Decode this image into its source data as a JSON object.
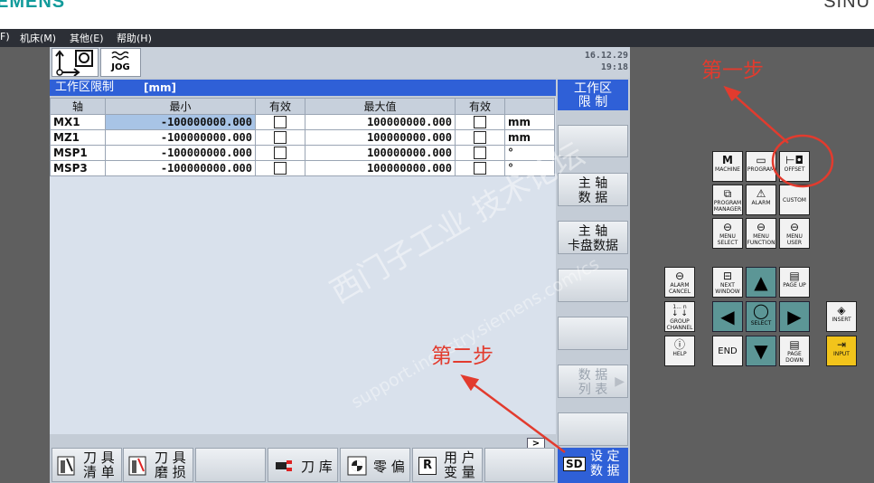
{
  "brand": {
    "left": "EMENS",
    "right": "SINU"
  },
  "menu": [
    "F)",
    "机床(M)",
    "其他(E)",
    "帮助(H)"
  ],
  "header": {
    "mode_label": "JOG",
    "date": "16.12.29",
    "time": "19:18"
  },
  "panel": {
    "title": "工作区限制",
    "unit": "[mm]"
  },
  "table": {
    "headers": [
      "轴",
      "最小",
      "有效",
      "最大值",
      "有效",
      ""
    ],
    "rows": [
      {
        "axis": "MX1",
        "min": "-100000000.000",
        "max": "100000000.000",
        "unit": "mm"
      },
      {
        "axis": "MZ1",
        "min": "-100000000.000",
        "max": "100000000.000",
        "unit": "mm"
      },
      {
        "axis": "MSP1",
        "min": "-100000000.000",
        "max": "100000000.000",
        "unit": "°"
      },
      {
        "axis": "MSP3",
        "min": "-100000000.000",
        "max": "100000000.000",
        "unit": "°"
      }
    ]
  },
  "more_label": ">",
  "vsoftkeys": [
    {
      "line1": "工作区",
      "line2": "限 制"
    },
    {
      "line1": "",
      "line2": ""
    },
    {
      "line1": "主 轴",
      "line2": "数 据"
    },
    {
      "line1": "主  轴",
      "line2": "卡盘数据"
    },
    {
      "line1": "",
      "line2": ""
    },
    {
      "line1": "",
      "line2": ""
    },
    {
      "line1": "数 据",
      "line2": "列 表"
    },
    {
      "line1": "",
      "line2": ""
    }
  ],
  "hsoftkeys": [
    {
      "line1": "刀 具",
      "line2": "清 单"
    },
    {
      "line1": "刀 具",
      "line2": "磨 损"
    },
    {
      "line1": "",
      "line2": ""
    },
    {
      "label": "刀 库"
    },
    {
      "label": "零 偏"
    },
    {
      "line1": "用 户",
      "line2": "变 量"
    },
    {
      "line1": "",
      "line2": ""
    }
  ],
  "sd": {
    "badge": "SD",
    "line1": "设 定",
    "line2": "数 据"
  },
  "keys": {
    "machine": "MACHINE",
    "program": "PROGRAM",
    "offset": "OFFSET",
    "program_manager": "PROGRAM MANAGER",
    "alarm": "ALARM",
    "custom": "CUSTOM",
    "menu_select": "MENU SELECT",
    "menu_function": "MENU FUNCTION",
    "menu_user": "MENU USER",
    "alarm_cancel": "ALARM CANCEL",
    "next_window": "NEXT WINDOW",
    "page_up": "PAGE UP",
    "group_channel": "GROUP CHANNEL",
    "select": "SELECT",
    "insert": "INSERT",
    "help": "HELP",
    "end": "END",
    "page_down": "PAGE DOWN",
    "input": "INPUT",
    "group_nums": "1... n"
  },
  "annotations": {
    "step1": "第一步",
    "step2": "第二步"
  },
  "watermark": {
    "cn": "西门子工业  技术论坛",
    "en": "support.industry.siemens.com/cs"
  },
  "colors": {
    "accent": "#2f60d7",
    "annotation": "#e23b2e",
    "brand": "#119b9b",
    "arrow_keys": "#5c9696",
    "input_key": "#f2c41b"
  }
}
